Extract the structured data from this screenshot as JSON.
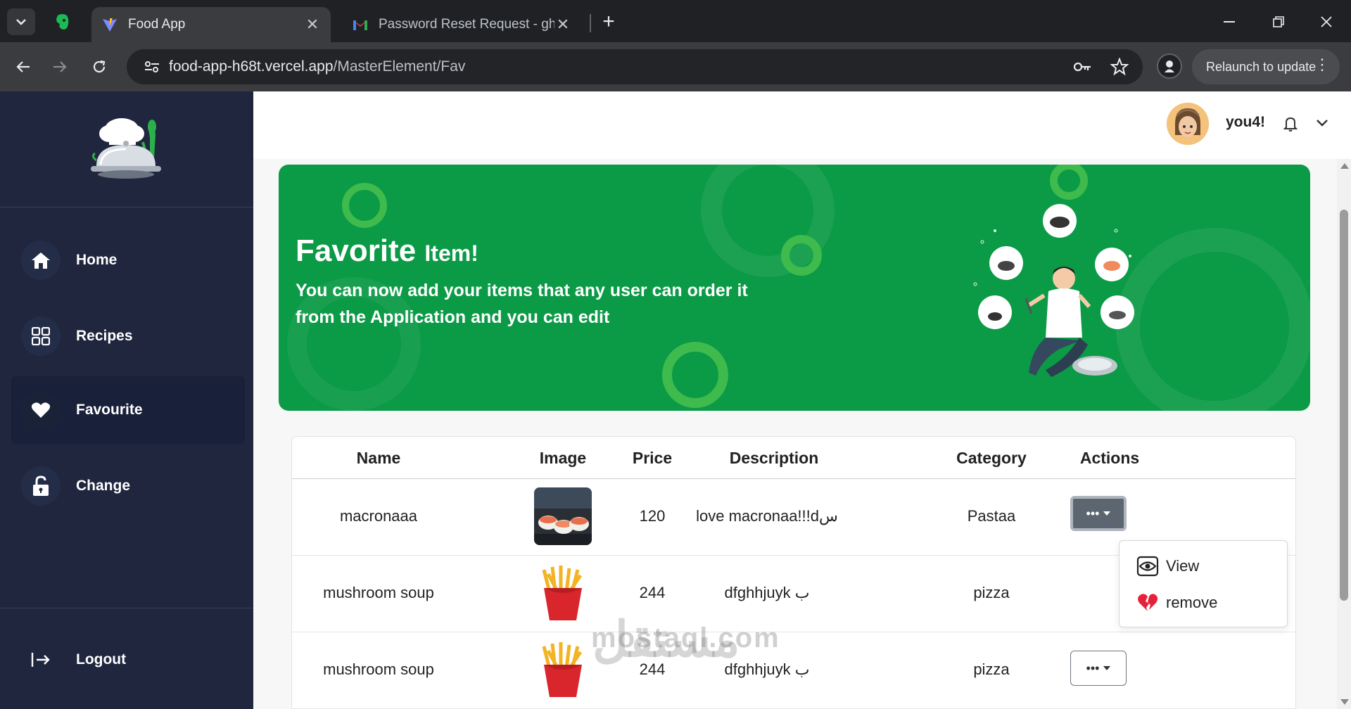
{
  "browser": {
    "tabs": [
      {
        "title": "Food App",
        "active": true
      },
      {
        "title": "Password Reset Request - ghhj",
        "active": false
      }
    ],
    "url_host": "food-app-h68t.vercel.app",
    "url_path": "/MasterElement/Fav",
    "relaunch_label": "Relaunch to update"
  },
  "sidebar": {
    "items": [
      {
        "label": "Home",
        "icon": "home-icon"
      },
      {
        "label": "Recipes",
        "icon": "grid-icon"
      },
      {
        "label": "Favourite",
        "icon": "heart-icon",
        "active": true
      },
      {
        "label": "Change",
        "icon": "unlock-icon"
      }
    ],
    "logout_label": "Logout"
  },
  "header": {
    "username": "you4!"
  },
  "banner": {
    "title": "Favorite",
    "title_sub": "Item!",
    "description": "You can now add your items that any user can order it from the Application and you can edit",
    "color": "#0b9a46"
  },
  "table": {
    "columns": [
      "Name",
      "Image",
      "Price",
      "Description",
      "Category",
      "Actions"
    ],
    "rows": [
      {
        "name": "macronaaa",
        "image": "sushi-image",
        "price": "120",
        "description": "love macronaa!!!dس",
        "category": "Pastaa"
      },
      {
        "name": "mushroom soup",
        "image": "fries-image",
        "price": "244",
        "description": "dfghhjuyk ب",
        "category": "pizza"
      },
      {
        "name": "mushroom soup",
        "image": "fries-image",
        "price": "244",
        "description": "dfghhjuyk ب",
        "category": "pizza"
      }
    ],
    "action_button_label": "•••"
  },
  "dropdown": {
    "items": [
      {
        "label": "View",
        "icon": "eye-icon"
      },
      {
        "label": "remove",
        "icon": "broken-heart-icon"
      }
    ]
  },
  "watermark": {
    "arabic": "مستقل",
    "latin": "mostaql.com"
  }
}
